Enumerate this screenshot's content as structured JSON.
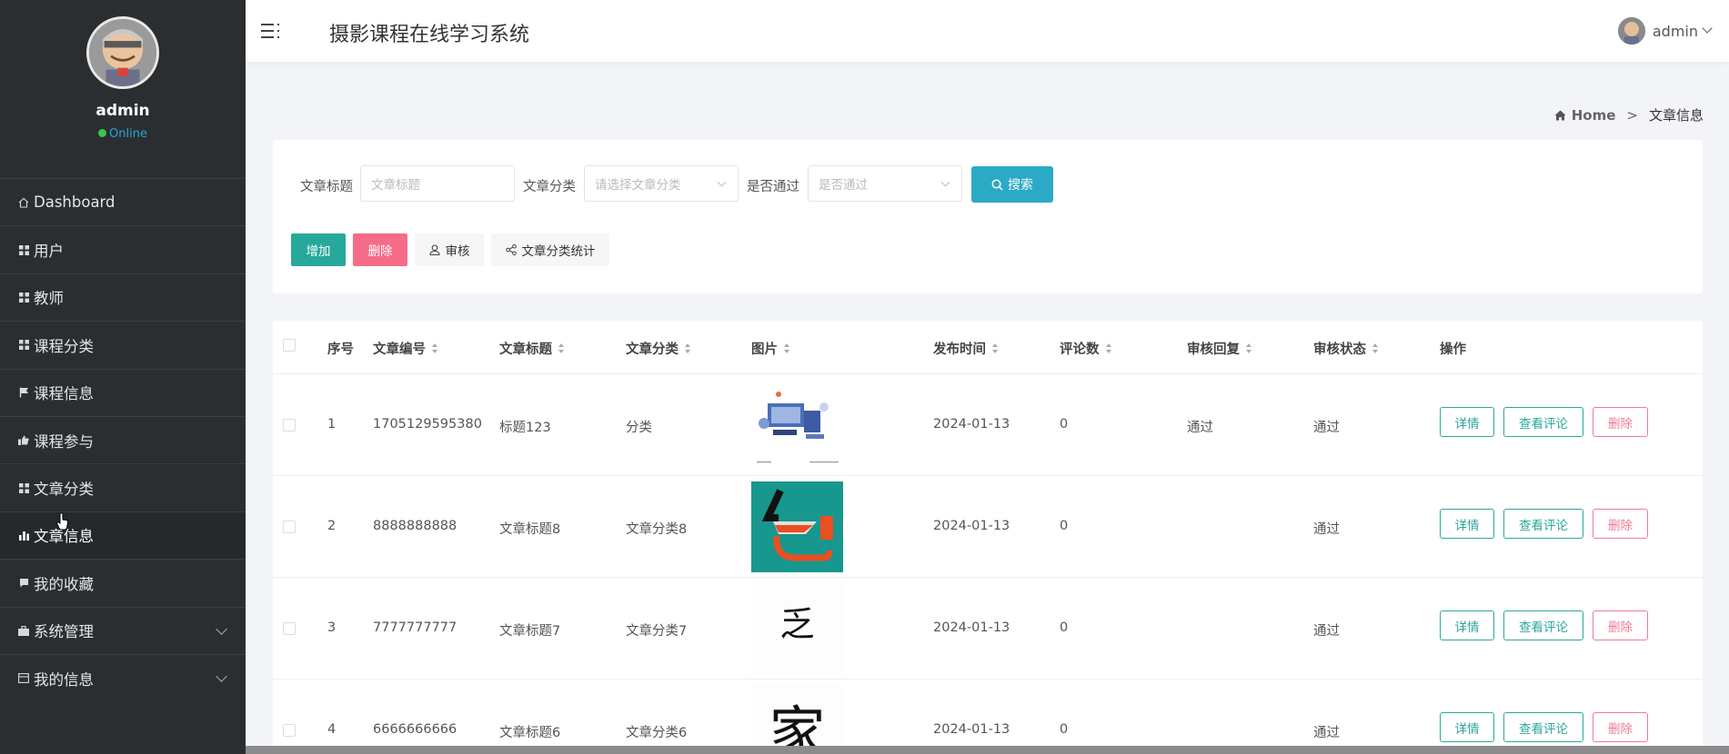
{
  "sidebar": {
    "profile": {
      "name": "admin",
      "status": "Online"
    },
    "items": [
      {
        "label": "Dashboard",
        "icon": "home-icon"
      },
      {
        "label": "用户",
        "icon": "grid-icon"
      },
      {
        "label": "教师",
        "icon": "grid-icon"
      },
      {
        "label": "课程分类",
        "icon": "grid-icon"
      },
      {
        "label": "课程信息",
        "icon": "flag-icon"
      },
      {
        "label": "课程参与",
        "icon": "thumbs-up-icon"
      },
      {
        "label": "文章分类",
        "icon": "grid-icon"
      },
      {
        "label": "文章信息",
        "icon": "bar-chart-icon",
        "active": true
      },
      {
        "label": "我的收藏",
        "icon": "comment-icon"
      },
      {
        "label": "系统管理",
        "icon": "briefcase-icon",
        "expandable": true
      },
      {
        "label": "我的信息",
        "icon": "id-card-icon",
        "expandable": true
      }
    ]
  },
  "header": {
    "title": "摄影课程在线学习系统",
    "user": "admin"
  },
  "breadcrumb": {
    "home": "Home",
    "separator": ">",
    "current": "文章信息"
  },
  "search": {
    "title_label": "文章标题",
    "title_placeholder": "文章标题",
    "category_label": "文章分类",
    "category_placeholder": "请选择文章分类",
    "approved_label": "是否通过",
    "approved_placeholder": "是否通过",
    "search_button": "搜索"
  },
  "actions": {
    "add": "增加",
    "delete": "删除",
    "audit": "审核",
    "stats": "文章分类统计"
  },
  "table": {
    "columns": [
      "序号",
      "文章编号",
      "文章标题",
      "文章分类",
      "图片",
      "发布时间",
      "评论数",
      "审核回复",
      "审核状态",
      "操作"
    ],
    "row_buttons": {
      "detail": "详情",
      "comments": "查看评论",
      "delete": "删除"
    },
    "rows": [
      {
        "index": "1",
        "article_no": "1705129595380",
        "title": "标题123",
        "category": "分类",
        "image": "illustration-thumbnail",
        "published": "2024-01-13",
        "comments": "0",
        "reply": "通过",
        "status": "通过"
      },
      {
        "index": "2",
        "article_no": "8888888888",
        "title": "文章标题8",
        "category": "文章分类8",
        "image": "calligraphy-teal-thumbnail",
        "published": "2024-01-13",
        "comments": "0",
        "reply": "",
        "status": "通过"
      },
      {
        "index": "3",
        "article_no": "7777777777",
        "title": "文章标题7",
        "category": "文章分类7",
        "image": "calligraphy-character-thumbnail",
        "image_text": "乏",
        "published": "2024-01-13",
        "comments": "0",
        "reply": "",
        "status": "通过"
      },
      {
        "index": "4",
        "article_no": "6666666666",
        "title": "文章标题6",
        "category": "文章分类6",
        "image": "calligraphy-character-thumbnail",
        "image_text": "家",
        "published": "2024-01-13",
        "comments": "0",
        "reply": "",
        "status": "通过"
      }
    ]
  },
  "colors": {
    "sidebar_bg": "#2b2e31",
    "primary_teal": "#26a99a",
    "search_blue": "#2baac5",
    "delete_pink": "#f56c89",
    "online_green": "#37c84f"
  }
}
